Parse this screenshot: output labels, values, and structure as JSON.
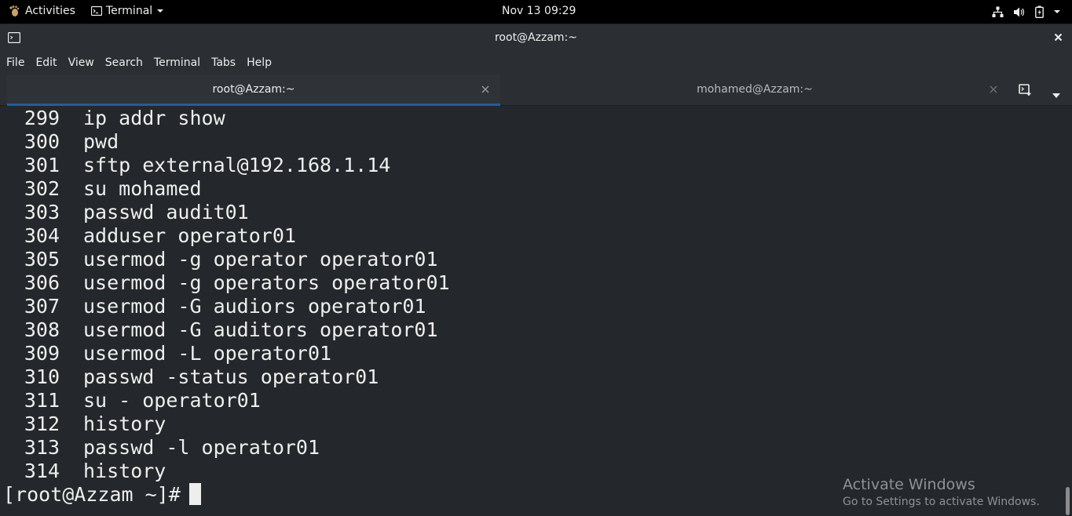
{
  "topbar": {
    "activities_label": "Activities",
    "app_menu_label": "Terminal",
    "clock": "Nov 13  09:29"
  },
  "window": {
    "title": "root@Azzam:~"
  },
  "menubar": {
    "items": [
      "File",
      "Edit",
      "View",
      "Search",
      "Terminal",
      "Tabs",
      "Help"
    ]
  },
  "tabs": [
    {
      "label": "root@Azzam:~",
      "active": true
    },
    {
      "label": "mohamed@Azzam:~",
      "active": false
    }
  ],
  "terminal": {
    "history": [
      {
        "num": "299",
        "cmd": "ip addr show"
      },
      {
        "num": "300",
        "cmd": "pwd"
      },
      {
        "num": "301",
        "cmd": "sftp external@192.168.1.14"
      },
      {
        "num": "302",
        "cmd": "su mohamed"
      },
      {
        "num": "303",
        "cmd": "passwd audit01"
      },
      {
        "num": "304",
        "cmd": "adduser operator01"
      },
      {
        "num": "305",
        "cmd": "usermod -g operator operator01"
      },
      {
        "num": "306",
        "cmd": "usermod -g operators operator01"
      },
      {
        "num": "307",
        "cmd": "usermod -G audiors operator01"
      },
      {
        "num": "308",
        "cmd": "usermod -G auditors operator01"
      },
      {
        "num": "309",
        "cmd": "usermod -L operator01"
      },
      {
        "num": "310",
        "cmd": "passwd -status operator01"
      },
      {
        "num": "311",
        "cmd": "su - operator01"
      },
      {
        "num": "312",
        "cmd": "history"
      },
      {
        "num": "313",
        "cmd": "passwd -l operator01"
      },
      {
        "num": "314",
        "cmd": "history"
      }
    ],
    "prompt": "[root@Azzam ~]#"
  },
  "watermark": {
    "title": "Activate Windows",
    "subtitle": "Go to Settings to activate Windows."
  },
  "colors": {
    "terminal_bg": "#24272b",
    "chrome_bg": "#2b2e33",
    "text": "#eeeeec",
    "active_tab_accent": "#215d9c"
  }
}
